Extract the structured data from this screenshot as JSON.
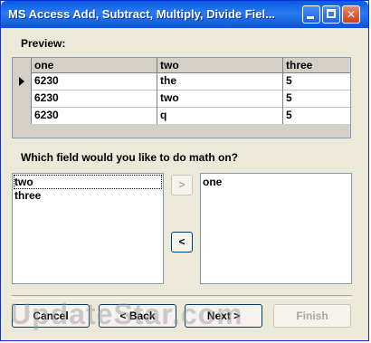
{
  "window": {
    "title": "MS Access Add, Subtract, Multiply, Divide Fiel..."
  },
  "preview": {
    "label": "Preview:",
    "columns": [
      "one",
      "two",
      "three"
    ],
    "rows": [
      [
        "6230",
        "the",
        "5"
      ],
      [
        "6230",
        "two",
        "5"
      ],
      [
        "6230",
        "q",
        "5"
      ]
    ]
  },
  "question": "Which field would you like to do math on?",
  "available_fields": [
    "two",
    "three"
  ],
  "selected_fields": [
    "one"
  ],
  "move_right_label": ">",
  "move_left_label": "<",
  "buttons": {
    "cancel": "Cancel",
    "back": "< Back",
    "next": "Next >",
    "finish": "Finish"
  },
  "watermark": "UpdateStar.com"
}
